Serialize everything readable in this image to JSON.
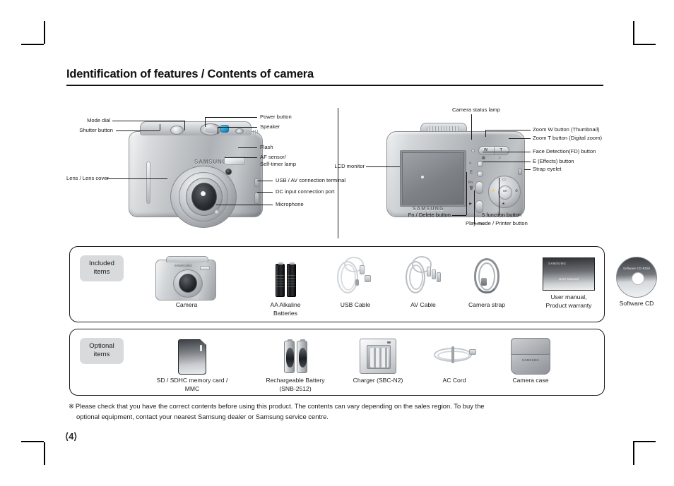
{
  "page_title": "Identification of features / Contents of camera",
  "page_number": "⟨4⟩",
  "front_camera": {
    "brand": "SAMSUNG",
    "labels_left": [
      {
        "text": "Mode dial"
      },
      {
        "text": "Shutter button"
      },
      {
        "text": "Lens / Lens cover"
      }
    ],
    "labels_right": [
      {
        "text": "Power button"
      },
      {
        "text": "Speaker"
      },
      {
        "text": "Flash"
      },
      {
        "text": "AF sensor/"
      },
      {
        "text": "Self-timer lamp"
      },
      {
        "text": "USB / AV connection terminal"
      },
      {
        "text": "DC input  connection port"
      },
      {
        "text": "Microphone"
      }
    ]
  },
  "rear_camera": {
    "brand": "SAMSUNG",
    "zoom_w_mark": "W",
    "zoom_t_mark": "T",
    "fn_chip": "Fn",
    "play_chip": "▶",
    "ok_chip": "OK",
    "labels": [
      {
        "text": "Camera status lamp"
      },
      {
        "text": "Zoom W button (Thumbnail)"
      },
      {
        "text": "Zoom T button (Digital zoom)"
      },
      {
        "text": "Face Detection(FD) button"
      },
      {
        "text": "E (Effects) button"
      },
      {
        "text": "Strap eyelet"
      },
      {
        "text": "LCD monitor"
      },
      {
        "text": "Fn / Delete button"
      },
      {
        "text": "Play mode / Printer button"
      },
      {
        "text": "5 function button"
      }
    ]
  },
  "included": {
    "badge_line1": "Included",
    "badge_line2": "items",
    "items": [
      {
        "caption_1": "Camera",
        "caption_2": ""
      },
      {
        "caption_1": "AA Alkaline",
        "caption_2": "Batteries"
      },
      {
        "caption_1": "USB Cable",
        "caption_2": ""
      },
      {
        "caption_1": "AV Cable",
        "caption_2": ""
      },
      {
        "caption_1": "Camera strap",
        "caption_2": ""
      },
      {
        "caption_1": "User manual,",
        "caption_2": "Product warranty"
      },
      {
        "caption_1": "Software CD",
        "caption_2": ""
      }
    ],
    "manual_cover_title": "User Manual",
    "manual_cover_logo": "SAMSUNG",
    "cd_label": "Software CD-ROM",
    "camera_art_brand": "SAMSUNG"
  },
  "optional": {
    "badge_line1": "Optional",
    "badge_line2": "items",
    "items": [
      {
        "caption_1": "SD / SDHC memory card /",
        "caption_2": "MMC"
      },
      {
        "caption_1": "Rechargeable Battery",
        "caption_2": "(SNB-2512)"
      },
      {
        "caption_1": "Charger (SBC-N2)",
        "caption_2": ""
      },
      {
        "caption_1": "AC Cord",
        "caption_2": ""
      },
      {
        "caption_1": "Camera case",
        "caption_2": ""
      }
    ],
    "case_brand": "SAMSUNG"
  },
  "footnote": {
    "mark": "※",
    "line1": "Please check that you have the correct contents before using this product. The contents can vary depending on the sales region. To buy the",
    "line2": "optional equipment, contact your nearest Samsung dealer or Samsung service centre."
  }
}
